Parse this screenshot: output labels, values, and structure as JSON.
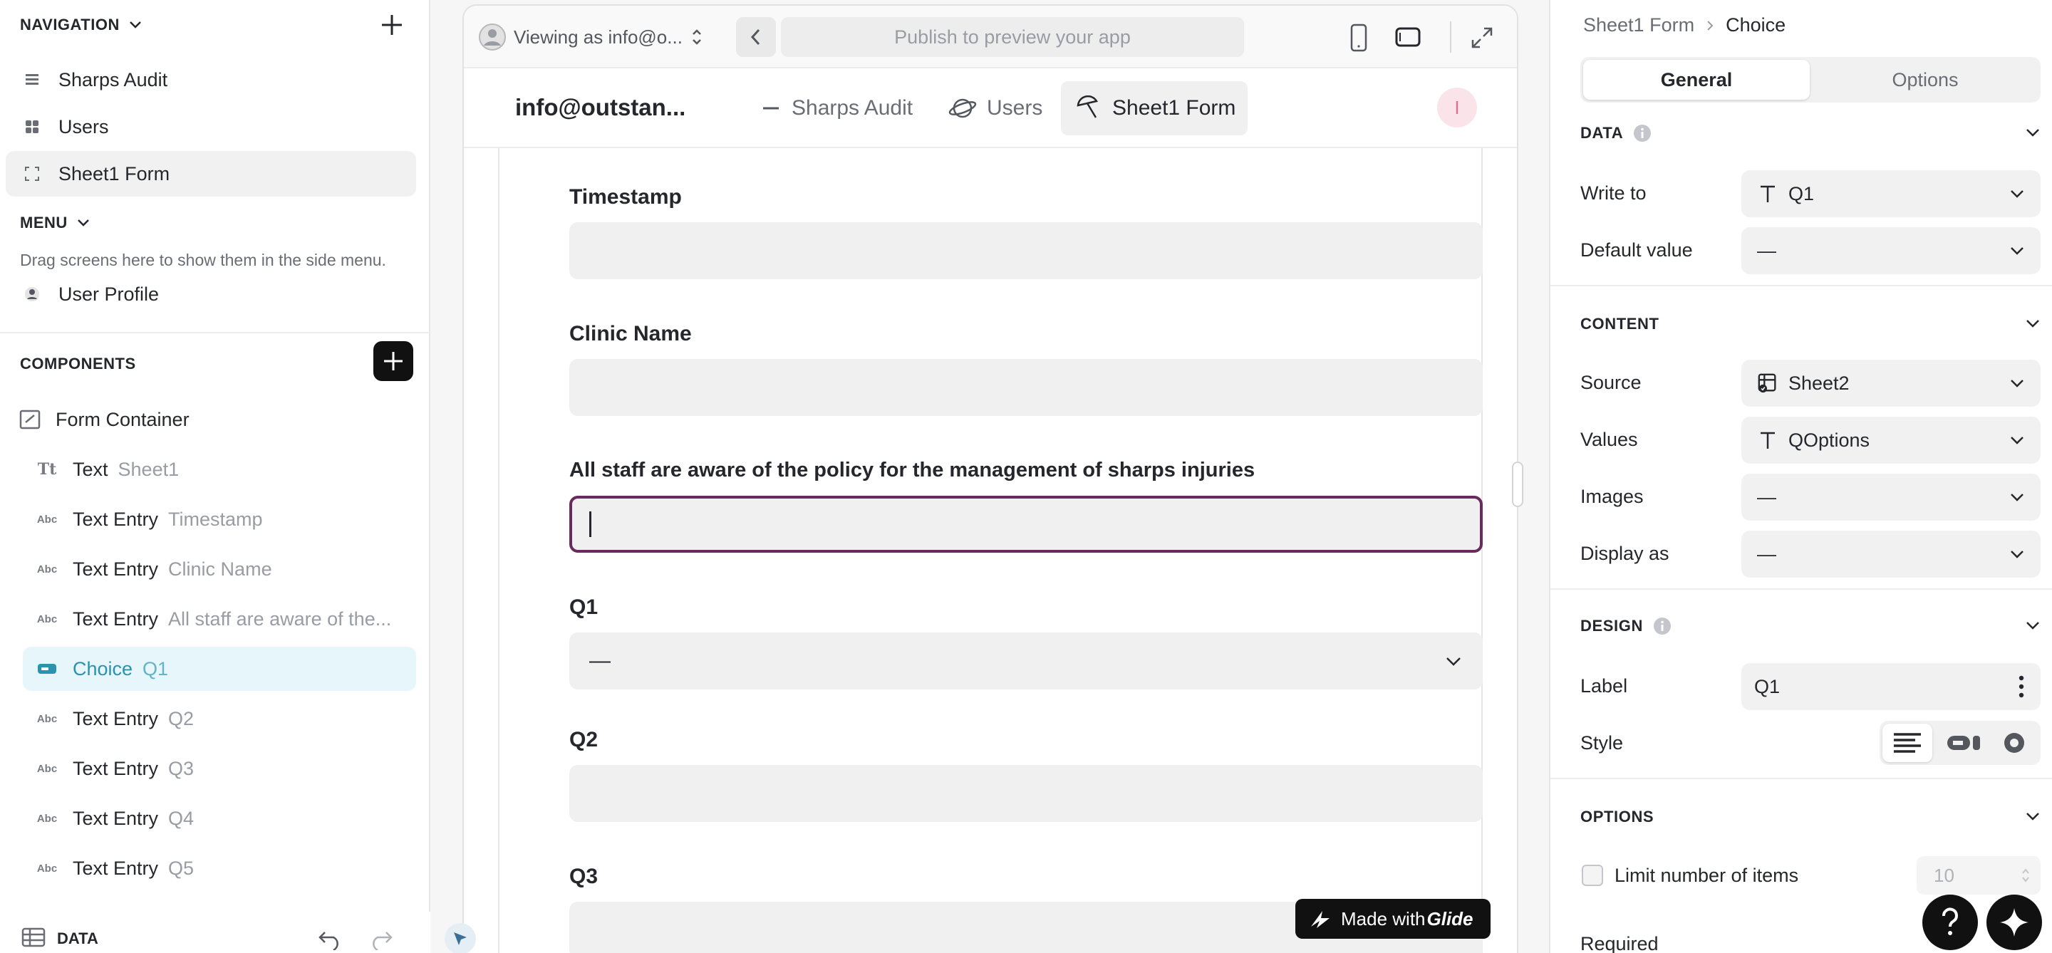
{
  "left": {
    "navigation": {
      "heading": "NAVIGATION",
      "items": [
        {
          "label": "Sharps Audit",
          "icon": "table-icon"
        },
        {
          "label": "Users",
          "icon": "grid-icon"
        },
        {
          "label": "Sheet1 Form",
          "icon": "form-icon",
          "selected": true
        }
      ]
    },
    "menu": {
      "heading": "MENU",
      "hint": "Drag screens here to show them in the side menu.",
      "items": [
        {
          "label": "User Profile",
          "icon": "user-icon"
        }
      ]
    },
    "components": {
      "heading": "COMPONENTS",
      "items": [
        {
          "label": "Form Container",
          "sub": "",
          "icon": "form-container-icon"
        },
        {
          "label": "Text",
          "sub": "Sheet1",
          "icon": "Tt"
        },
        {
          "label": "Text Entry",
          "sub": "Timestamp",
          "icon": "Abc"
        },
        {
          "label": "Text Entry",
          "sub": "Clinic Name",
          "icon": "Abc"
        },
        {
          "label": "Text Entry",
          "sub": "All staff are aware of the...",
          "icon": "Abc"
        },
        {
          "label": "Choice",
          "sub": "Q1",
          "icon": "choice-icon",
          "selected": true
        },
        {
          "label": "Text Entry",
          "sub": "Q2",
          "icon": "Abc"
        },
        {
          "label": "Text Entry",
          "sub": "Q3",
          "icon": "Abc"
        },
        {
          "label": "Text Entry",
          "sub": "Q4",
          "icon": "Abc"
        },
        {
          "label": "Text Entry",
          "sub": "Q5",
          "icon": "Abc"
        }
      ]
    },
    "footer": {
      "data_label": "DATA"
    }
  },
  "preview": {
    "viewing_as": "Viewing as info@o...",
    "url_placeholder": "Publish to preview your app",
    "app_title": "info@outstan...",
    "tabs": [
      {
        "label": "Sharps Audit"
      },
      {
        "label": "Users"
      },
      {
        "label": "Sheet1 Form",
        "active": true
      }
    ],
    "avatar_letter": "I",
    "fields": [
      {
        "label": "Timestamp",
        "type": "text"
      },
      {
        "label": "Clinic Name",
        "type": "text"
      },
      {
        "label": "All staff are aware of the policy for the management of sharps injuries",
        "type": "text",
        "focused": true
      },
      {
        "label": "Q1",
        "type": "choice",
        "value": "—"
      },
      {
        "label": "Q2",
        "type": "text"
      },
      {
        "label": "Q3",
        "type": "text"
      }
    ],
    "badge": {
      "prefix": "Made with ",
      "brand": "Glide"
    }
  },
  "right": {
    "breadcrumb": {
      "parent": "Sheet1 Form",
      "current": "Choice"
    },
    "tabs": [
      {
        "label": "General",
        "active": true
      },
      {
        "label": "Options"
      }
    ],
    "data": {
      "heading": "DATA",
      "write_to": {
        "label": "Write to",
        "value": "Q1"
      },
      "default_value": {
        "label": "Default value",
        "value": "—"
      }
    },
    "content": {
      "heading": "CONTENT",
      "source": {
        "label": "Source",
        "value": "Sheet2"
      },
      "values": {
        "label": "Values",
        "value": "QOptions"
      },
      "images": {
        "label": "Images",
        "value": "—"
      },
      "display_as": {
        "label": "Display as",
        "value": "—"
      }
    },
    "design": {
      "heading": "DESIGN",
      "label": {
        "label": "Label",
        "value": "Q1"
      },
      "style": {
        "label": "Style"
      }
    },
    "options": {
      "heading": "OPTIONS",
      "limit": {
        "label": "Limit number of items",
        "value": "10"
      },
      "required": {
        "label": "Required"
      }
    }
  },
  "colors": {
    "accent": "#2a93b0",
    "focus": "#6b2a5d",
    "dark": "#111111",
    "avatar_bg": "#fbe3ea"
  }
}
